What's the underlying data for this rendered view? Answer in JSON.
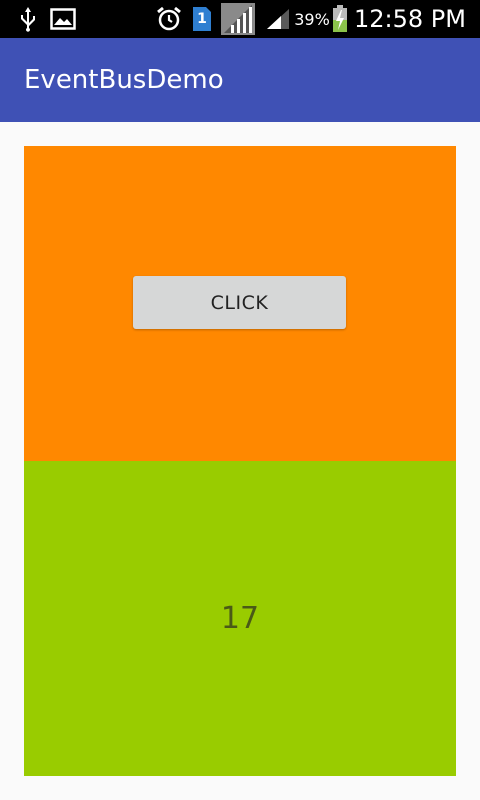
{
  "status_bar": {
    "battery_percent": "39%",
    "time": "12:58 PM",
    "sim_slot": "1",
    "icons": [
      "usb-icon",
      "image-icon",
      "alarm-icon",
      "sim-card-icon",
      "no-signal-icon",
      "signal-icon",
      "battery-charging-icon"
    ]
  },
  "app_bar": {
    "title": "EventBusDemo"
  },
  "top_panel": {
    "button_label": "CLICK",
    "color": "#ff8800"
  },
  "bottom_panel": {
    "counter_value": "17",
    "color": "#99cc00"
  },
  "colors": {
    "primary": "#3f51b5",
    "status_bar": "#000000",
    "background": "#fafafa"
  }
}
